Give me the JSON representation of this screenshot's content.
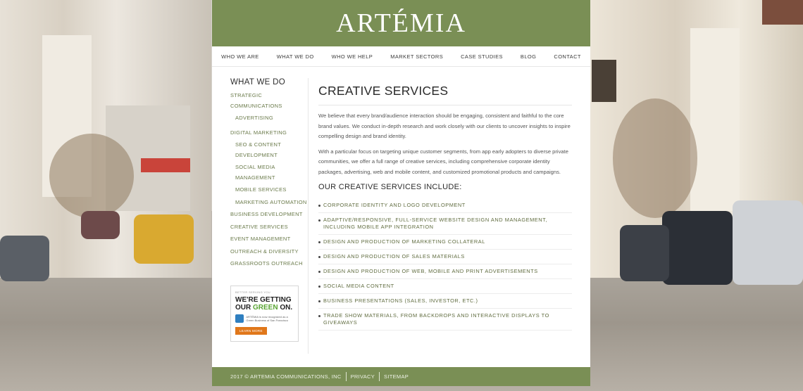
{
  "brand": {
    "logo_text": "ARTÉMIA"
  },
  "nav": {
    "items": [
      {
        "label": "WHO WE ARE"
      },
      {
        "label": "WHAT WE DO"
      },
      {
        "label": "WHO WE HELP"
      },
      {
        "label": "MARKET SECTORS"
      },
      {
        "label": "CASE STUDIES"
      },
      {
        "label": "BLOG"
      },
      {
        "label": "CONTACT"
      }
    ]
  },
  "sidebar": {
    "title": "WHAT WE DO",
    "items": [
      {
        "label": "STRATEGIC COMMUNICATIONS",
        "level": 0
      },
      {
        "label": "ADVERTISING",
        "level": 1
      },
      {
        "label": "DIGITAL MARKETING",
        "level": 0
      },
      {
        "label": "SEO & CONTENT DEVELOPMENT",
        "level": 1
      },
      {
        "label": "SOCIAL MEDIA MANAGEMENT",
        "level": 1
      },
      {
        "label": "MOBILE SERVICES",
        "level": 1
      },
      {
        "label": "MARKETING AUTOMATION",
        "level": 1
      },
      {
        "label": "BUSINESS DEVELOPMENT",
        "level": 0
      },
      {
        "label": "CREATIVE SERVICES",
        "level": 0
      },
      {
        "label": "EVENT MANAGEMENT",
        "level": 0
      },
      {
        "label": "OUTREACH & DIVERSITY",
        "level": 0
      },
      {
        "label": "GRASSROOTS OUTREACH",
        "level": 0
      }
    ]
  },
  "ad": {
    "kicker": "BETTER SERVING YOU",
    "headline_1": "WE'RE GETTING",
    "headline_2a": "OUR ",
    "headline_2b": "GREEN",
    "headline_2c": " ON.",
    "note": "ARTÉMIA is now recognized as a Green Business of San Francisco",
    "button_label": "LEARN MORE"
  },
  "main": {
    "title": "CREATIVE SERVICES",
    "paragraph_1": "We believe that every brand/audience interaction should be engaging, consistent and faithful to the core brand values. We conduct in-depth research and work closely with our clients to uncover insights to inspire compelling design and brand identity.",
    "paragraph_2": "With a particular focus on targeting unique customer segments, from app early adopters to diverse private communities, we offer a full range of creative services, including comprehensive corporate identity packages, advertising, web and mobile content, and customized promotional products and campaigns.",
    "subheading": "OUR CREATIVE SERVICES INCLUDE:",
    "services": [
      "CORPORATE IDENTITY AND LOGO DEVELOPMENT",
      "ADAPTIVE/RESPONSIVE, FULL-SERVICE WEBSITE DESIGN AND MANAGEMENT, INCLUDING MOBILE APP INTEGRATION",
      "DESIGN AND PRODUCTION OF MARKETING COLLATERAL",
      "DESIGN AND PRODUCTION OF SALES MATERIALS",
      "DESIGN AND PRODUCTION OF WEB, MOBILE AND PRINT ADVERTISEMENTS",
      "SOCIAL MEDIA CONTENT",
      "BUSINESS PRESENTATIONS (SALES, INVESTOR, ETC.)",
      "TRADE SHOW MATERIALS, FROM BACKDROPS AND INTERACTIVE DISPLAYS TO GIVEAWAYS"
    ]
  },
  "footer": {
    "copyright": "2017 © ARTEMIA COMMUNICATIONS, INC",
    "privacy": "PRIVACY",
    "sitemap": "SITEMAP"
  }
}
